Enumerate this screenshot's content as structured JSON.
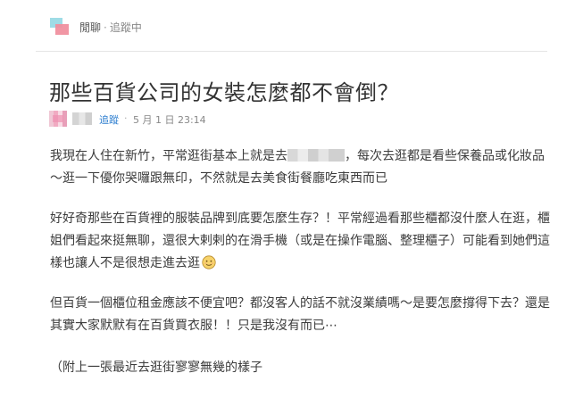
{
  "header": {
    "board_name": "閒聊",
    "separator": "·",
    "follow_status": "追蹤中"
  },
  "post": {
    "title": "那些百貨公司的女裝怎麼都不會倒？",
    "follow_label": "追蹤",
    "dot": "·",
    "date": "5 月 1 日 23:14",
    "paragraphs": {
      "p1a": "我現在人住在新竹，平常逛街基本上就是去",
      "p1b": "，每次去逛都是看些保養品或化妝品～逛一下優你哭囉跟無印，不然就是去美食街餐廳吃東西而已",
      "p2": "好好奇那些在百貨裡的服裝品牌到底要怎麼生存？！平常經過看那些櫃都沒什麼人在逛，櫃姐們看起來挺無聊，還很大剌剌的在滑手機（或是在操作電腦、整理櫃子）可能看到她們這樣也讓人不是很想走進去逛",
      "p3": "但百貨一個櫃位租金應該不便宜吧？都沒客人的話不就沒業績嗎～是要怎麼撐得下去？還是其實大家默默有在百貨買衣服！！只是我沒有而已⋯",
      "p4": "（附上一張最近去逛街寥寥無幾的樣子"
    }
  },
  "icons": {
    "logo": "dcard-logo-icon",
    "emoji": "awkward-smile-emoji-icon"
  },
  "colors": {
    "link": "#2f7fd0",
    "logo_cyan": "#9fdce6",
    "logo_pink": "#f08d9c"
  }
}
